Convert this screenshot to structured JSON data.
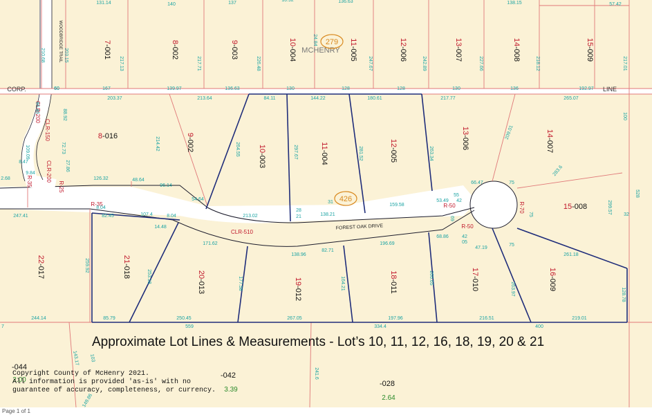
{
  "title": "Approximate Lot Lines & Measurements - Lot’s 10, 11, 12, 16, 18, 19, 20 & 21",
  "copyright": [
    "Copyright County of McHenry 2021.",
    "All information is provided 'as-is' with no",
    "guarantee of accuracy, completeness, or currency."
  ],
  "footer": "Page 1 of 1",
  "streets": {
    "woodbridge": "WOODBRIDGE TRAIL",
    "forest_oak": "FOREST OAK DRIVE"
  },
  "boundary": {
    "corp": "CORP.",
    "line": "LINE",
    "mchenry": "MCHENRY"
  },
  "badges": {
    "top": "279",
    "center": "426"
  },
  "colors": {
    "lot_line": "#e07878",
    "highlight": "#1f2d7a",
    "road": "#ffffff",
    "dim_text": "#1aa3a3",
    "lot_text": "#c0182b",
    "acre_text": "#2a8a2a"
  },
  "lots": [
    {
      "pre": "7",
      "num": "-001"
    },
    {
      "pre": "8",
      "num": "-002"
    },
    {
      "pre": "9",
      "num": "-003"
    },
    {
      "pre": "10",
      "num": "-004"
    },
    {
      "pre": "11",
      "num": "-005"
    },
    {
      "pre": "12",
      "num": "-006"
    },
    {
      "pre": "13",
      "num": "-007"
    },
    {
      "pre": "14",
      "num": "-008"
    },
    {
      "pre": "15",
      "num": "-009"
    },
    {
      "pre": "8",
      "num": "-016"
    },
    {
      "pre": "9",
      "num": "-002"
    },
    {
      "pre": "10",
      "num": "-003"
    },
    {
      "pre": "11",
      "num": "-004"
    },
    {
      "pre": "12",
      "num": "-005"
    },
    {
      "pre": "13",
      "num": "-006"
    },
    {
      "pre": "14",
      "num": "-007"
    },
    {
      "pre": "15",
      "num": "-008"
    },
    {
      "pre": "22",
      "num": "-017"
    },
    {
      "pre": "21",
      "num": "-018"
    },
    {
      "pre": "20",
      "num": "-013"
    },
    {
      "pre": "19",
      "num": "-012"
    },
    {
      "pre": "18",
      "num": "-011"
    },
    {
      "pre": "17",
      "num": "-010"
    },
    {
      "pre": "16",
      "num": "-009"
    },
    {
      "pre": "",
      "num": "-044"
    },
    {
      "pre": "",
      "num": "-042"
    },
    {
      "pre": "",
      "num": "-028"
    }
  ],
  "acres": [
    "2.00",
    "3.39",
    "2.64"
  ],
  "curves": [
    "CLR-200",
    "CLR-150",
    "CLR-200",
    "R-35",
    "R-25",
    "R-35",
    "CLR-510",
    "R-50",
    "R-70",
    "R-50"
  ],
  "dims": [
    "131.14",
    "140",
    "137",
    "10.92",
    "136.63",
    "138.15",
    "57.42",
    "210.68",
    "203.15",
    "217.13",
    "217.71",
    "226.48",
    "24.84",
    "247.67",
    "242.89",
    "227.66",
    "218.12",
    "217.01",
    "60",
    "167",
    "139.97",
    "136.63",
    "130",
    "128",
    "128",
    "130",
    "136",
    "192.97",
    "66.46",
    "203.37",
    "213.64",
    "84.11",
    "144.22",
    "180.61",
    "217.77",
    "265.07",
    "100",
    "109.09",
    "72.73",
    "88.92",
    "214.42",
    "264.55",
    "297.67",
    "281.52",
    "263.34",
    "209.01",
    "283.6",
    "8.47",
    "9.84",
    "27.86",
    "2.68",
    "126.32",
    "48.64",
    "96.14",
    "54.64",
    "213.02",
    "28",
    "21",
    "138.21",
    "159.58",
    "53.49",
    "55",
    "42",
    "66.47",
    "75",
    "75",
    "299.57",
    "528",
    "32",
    "247.41",
    "8.04",
    "82.45",
    "107.4",
    "14.48",
    "8.04",
    "171.62",
    "138.96",
    "82.71",
    "196.69",
    "68.86",
    "42",
    "05",
    "47.19",
    "75",
    "261.18",
    "259.92",
    "253.18",
    "177.58",
    "164.21",
    "266.65",
    "263.97",
    "128.78",
    "244.14",
    "85.79",
    "250.45",
    "267.05",
    "197.96",
    "216.51",
    "219.01",
    "559",
    "334.4",
    "400",
    "143.17",
    "103",
    "241.6",
    "149.86",
    "31",
    "7",
    "60",
    "69"
  ]
}
